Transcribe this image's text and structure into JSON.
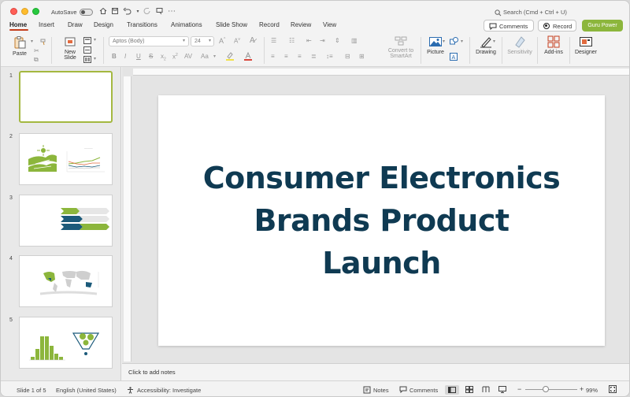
{
  "titlebar": {
    "autosave_label": "AutoSave",
    "search_placeholder": "Search (Cmd + Ctrl + U)"
  },
  "tabs": [
    {
      "label": "Home",
      "active": true
    },
    {
      "label": "Insert"
    },
    {
      "label": "Draw"
    },
    {
      "label": "Design"
    },
    {
      "label": "Transitions"
    },
    {
      "label": "Animations"
    },
    {
      "label": "Slide Show"
    },
    {
      "label": "Record"
    },
    {
      "label": "Review"
    },
    {
      "label": "View"
    }
  ],
  "header_buttons": {
    "comments": "Comments",
    "record": "Record",
    "guru": "Guru Power"
  },
  "ribbon": {
    "paste": "Paste",
    "new_slide_1": "New",
    "new_slide_2": "Slide",
    "font_name": "Aptos (Body)",
    "font_size": "24",
    "convert_1": "Convert to",
    "convert_2": "SmartArt",
    "picture": "Picture",
    "drawing": "Drawing",
    "sensitivity": "Sensitivity",
    "addins": "Add-ins",
    "designer": "Designer"
  },
  "slides": [
    {
      "number": "1"
    },
    {
      "number": "2"
    },
    {
      "number": "3"
    },
    {
      "number": "4"
    },
    {
      "number": "5"
    }
  ],
  "slide": {
    "title_line1": "Consumer Electronics",
    "title_line2": "Brands Product",
    "title_line3": "Launch"
  },
  "notes_placeholder": "Click to add notes",
  "status": {
    "slide_count": "Slide 1 of 5",
    "language": "English (United States)",
    "accessibility": "Accessibility: Investigate",
    "notes": "Notes",
    "comments": "Comments",
    "zoom": "99%"
  },
  "colors": {
    "accent_red": "#c43e1c",
    "guru_green": "#8cb63c",
    "title_navy": "#0f3a52",
    "selection_green": "#a4b840"
  }
}
